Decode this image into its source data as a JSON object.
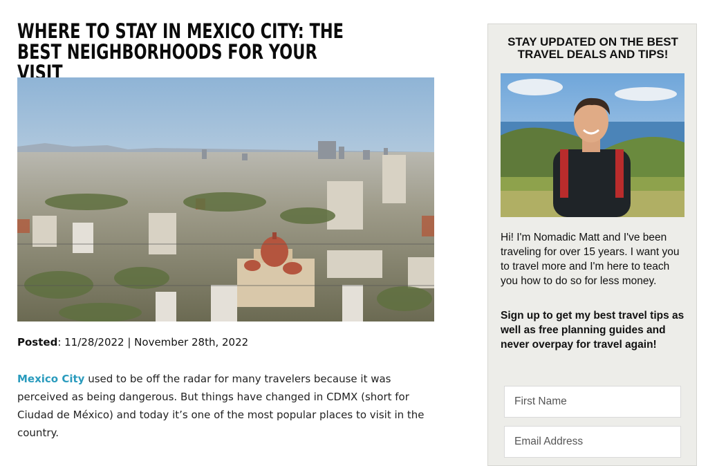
{
  "article": {
    "title": "WHERE TO STAY IN MEXICO CITY: THE BEST NEIGHBORHOODS FOR YOUR VISIT",
    "posted_label": "Posted",
    "posted_value": ": 11/28/2022 | November 28th, 2022",
    "intro_link": "Mexico City",
    "intro_text": " used to be off the radar for many travelers because it was perceived as being dangerous. But things have changed in CDMX (short for Ciudad de México) and today it’s one of the most popular places to visit in the country."
  },
  "sidebar": {
    "heading": "STAY UPDATED ON THE BEST TRAVEL DEALS AND TIPS!",
    "bio": "Hi! I'm Nomadic Matt and I've been traveling for over 15 years. I want you to travel more and I'm here to teach you how to do so for less money.",
    "cta": "Sign up to get my best travel tips as well as free planning guides and never overpay for travel again!",
    "first_name_placeholder": "First Name",
    "email_placeholder": "Email Address"
  },
  "colors": {
    "link": "#2a9bbd",
    "sidebar_bg": "#edede9"
  }
}
